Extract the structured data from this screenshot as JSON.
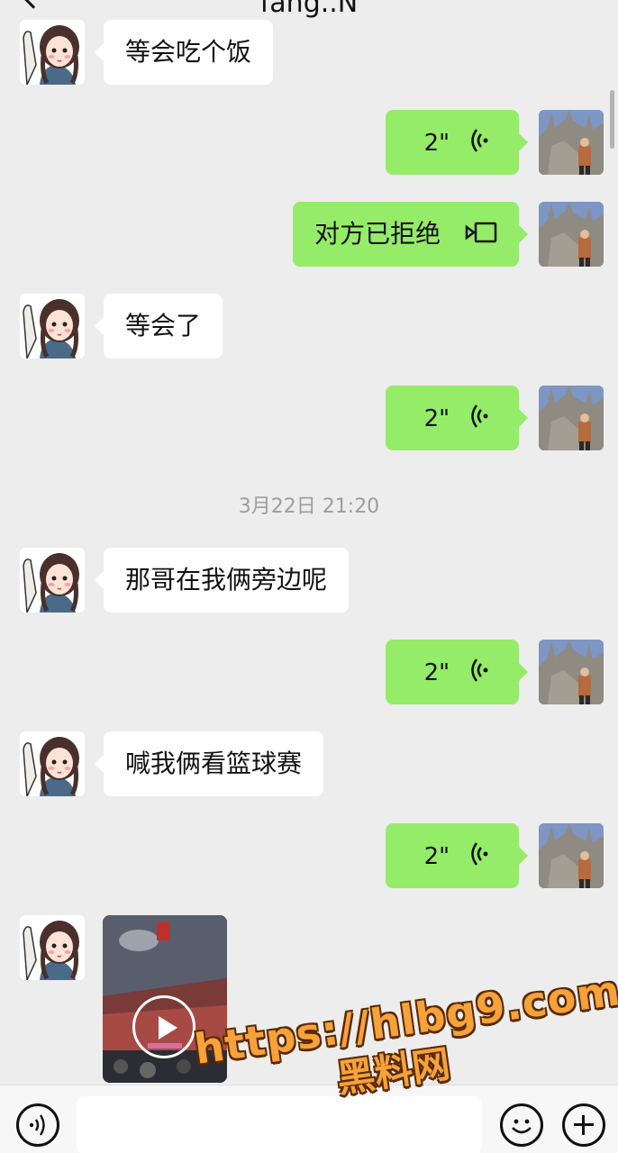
{
  "header": {
    "title": "fang..N"
  },
  "messages": [
    {
      "side": "left",
      "type": "text",
      "text": "等会吃个饭"
    },
    {
      "side": "right",
      "type": "voice",
      "duration": "2\""
    },
    {
      "side": "right",
      "type": "call",
      "text": "对方已拒绝",
      "icon": "video-call-icon"
    },
    {
      "side": "left",
      "type": "text",
      "text": "等会了"
    },
    {
      "side": "right",
      "type": "voice",
      "duration": "2\""
    },
    {
      "side": "system",
      "type": "timestamp",
      "text": "3月22日 21:20"
    },
    {
      "side": "left",
      "type": "text",
      "text": "那哥在我俩旁边呢"
    },
    {
      "side": "right",
      "type": "voice",
      "duration": "2\""
    },
    {
      "side": "left",
      "type": "text",
      "text": "喊我俩看篮球赛"
    },
    {
      "side": "right",
      "type": "voice",
      "duration": "2\""
    },
    {
      "side": "left",
      "type": "video",
      "icon": "play-icon"
    }
  ],
  "input_bar": {
    "placeholder": "",
    "icons": [
      "voice-mode-icon",
      "emoji-icon",
      "plus-icon"
    ]
  },
  "watermark": {
    "url": "https://hlbg9.com",
    "name": "黑料网"
  },
  "colors": {
    "bubble_mine": "#95ec69",
    "bubble_theirs": "#ffffff",
    "background": "#ededed",
    "watermark": "#f6a23a"
  }
}
